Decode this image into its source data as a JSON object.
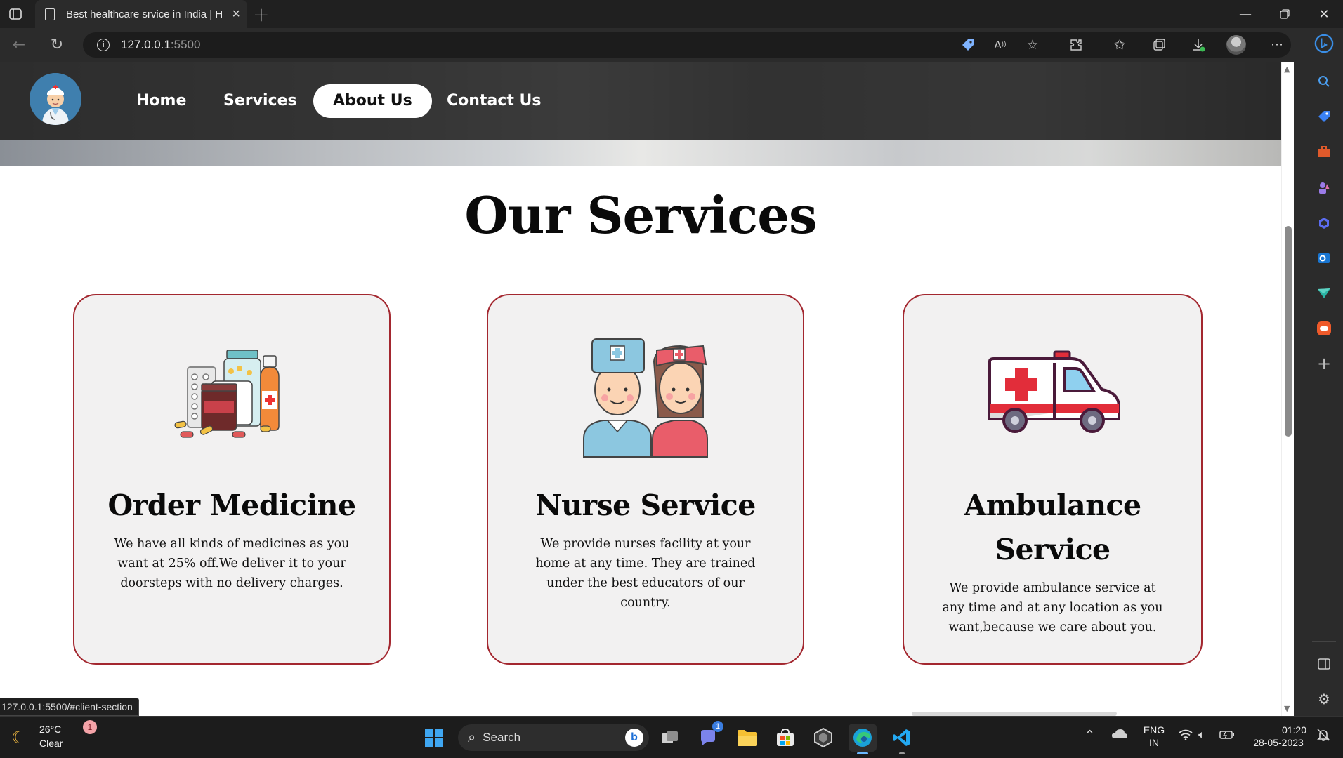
{
  "browser": {
    "tab_title": "Best healthcare srvice in India | H",
    "address_host": "127.0.0.1",
    "address_port": ":5500",
    "status_url": "127.0.0.1:5500/#client-section"
  },
  "nav": {
    "items": [
      {
        "label": "Home",
        "active": false
      },
      {
        "label": "Services",
        "active": false
      },
      {
        "label": "About Us",
        "active": true
      },
      {
        "label": "Contact Us",
        "active": false
      }
    ]
  },
  "services": {
    "heading": "Our Services",
    "cards": [
      {
        "title": "Order Medicine",
        "text": "We have all kinds of medicines as you want at 25% off.We deliver it to your doorsteps with no delivery charges.",
        "icon": "medicine-icon"
      },
      {
        "title": "Nurse Service",
        "text": "We provide nurses facility at your home at any time. They are trained under the best educators of our country.",
        "icon": "nurse-icon"
      },
      {
        "title": "Ambulance Service",
        "text": "We provide ambulance service at any time and at any location as you want,because we care about you.",
        "icon": "ambulance-icon"
      }
    ]
  },
  "taskbar": {
    "weather_temp": "26°C",
    "weather_desc": "Clear",
    "notification_count": "1",
    "search_label": "Search",
    "teams_badge": "1",
    "lang_top": "ENG",
    "lang_bottom": "IN",
    "time": "01:20",
    "date": "28-05-2023"
  },
  "colors": {
    "card_border": "#a3272f",
    "card_bg": "#f2f1f1",
    "nav_active_bg": "#ffffff"
  }
}
